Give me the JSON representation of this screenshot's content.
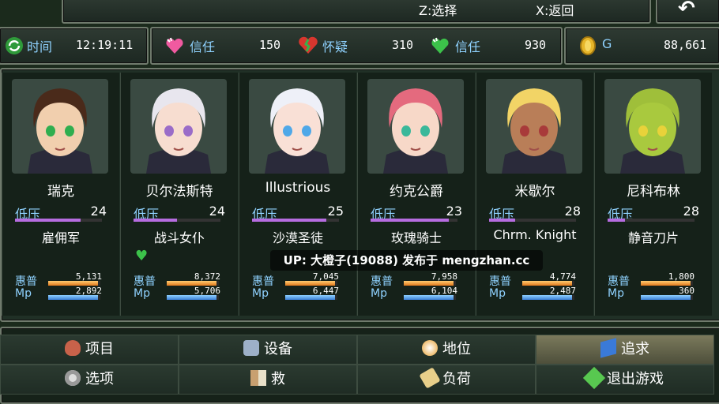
{
  "hints": {
    "select": "Z:选择",
    "back": "X:返回"
  },
  "stats": {
    "time_label": "时间",
    "time_value": "12:19:11",
    "trust_label": "信任",
    "trust_value": "150",
    "doubt_label": "怀疑",
    "doubt_value": "310",
    "trust2_label": "信任",
    "trust2_value": "930",
    "gold_label": "G",
    "gold_value": "88,661"
  },
  "party": [
    {
      "name": "瑞克",
      "status": "低压",
      "level": "24",
      "class": "雇佣军",
      "hp_label": "惠普",
      "hp": "5,131",
      "hp_ratio": 0.95,
      "mp_label": "Mp",
      "mp": "2,892",
      "mp_ratio": 0.95,
      "status_ratio": 0.75,
      "hair": "#4a2a1a",
      "skin": "#f1cfae",
      "eye": "#2fae4f"
    },
    {
      "name": "贝尔法斯特",
      "status": "低压",
      "level": "24",
      "class": "战斗女仆",
      "hp_label": "惠普",
      "hp": "8,372",
      "hp_ratio": 0.95,
      "mp_label": "Mp",
      "mp": "5,706",
      "mp_ratio": 0.95,
      "status_ratio": 0.5,
      "hair": "#e8e6ee",
      "skin": "#f7ddd0",
      "eye": "#9a6cc8"
    },
    {
      "name": "Illustrious",
      "status": "低压",
      "level": "25",
      "class": "沙漠圣徒",
      "hp_label": "惠普",
      "hp": "7,045",
      "hp_ratio": 0.95,
      "mp_label": "Mp",
      "mp": "6,447",
      "mp_ratio": 0.95,
      "status_ratio": 0.85,
      "hair": "#eef0f8",
      "skin": "#f9e0d6",
      "eye": "#4fa8e8"
    },
    {
      "name": "约克公爵",
      "status": "低压",
      "level": "23",
      "class": "玫瑰骑士",
      "hp_label": "惠普",
      "hp": "7,958",
      "hp_ratio": 0.95,
      "mp_label": "Mp",
      "mp": "6,104",
      "mp_ratio": 0.95,
      "status_ratio": 0.9,
      "hair": "#e46a7e",
      "skin": "#f7d8c8",
      "eye": "#3ab89a"
    },
    {
      "name": "米歇尔",
      "status": "低压",
      "level": "28",
      "class": "Chrm. Knight",
      "hp_label": "惠普",
      "hp": "4,774",
      "hp_ratio": 0.95,
      "mp_label": "Mp",
      "mp": "2,487",
      "mp_ratio": 0.95,
      "status_ratio": 0.3,
      "hair": "#f2d466",
      "skin": "#b97e58",
      "eye": "#a83a3a"
    },
    {
      "name": "尼科布林",
      "status": "低压",
      "level": "28",
      "class": "静音刀片",
      "hp_label": "惠普",
      "hp": "1,800",
      "hp_ratio": 0.95,
      "mp_label": "Mp",
      "mp": "360",
      "mp_ratio": 0.95,
      "status_ratio": 0.2,
      "hair": "#9fbf3a",
      "skin": "#a9c93e",
      "eye": "#e8d23a"
    }
  ],
  "watermark": "UP: 大橙子(19088) 发布于 mengzhan.cc",
  "menu": {
    "items": "项目",
    "equipment": "设备",
    "status": "地位",
    "chase": "追求",
    "options": "选项",
    "rescue": "救",
    "burden": "负荷",
    "quit": "退出游戏"
  },
  "colors": {
    "accent": "#8fd2ff",
    "selected": "#7b7a5c",
    "status_bar": "#b66ce0"
  }
}
